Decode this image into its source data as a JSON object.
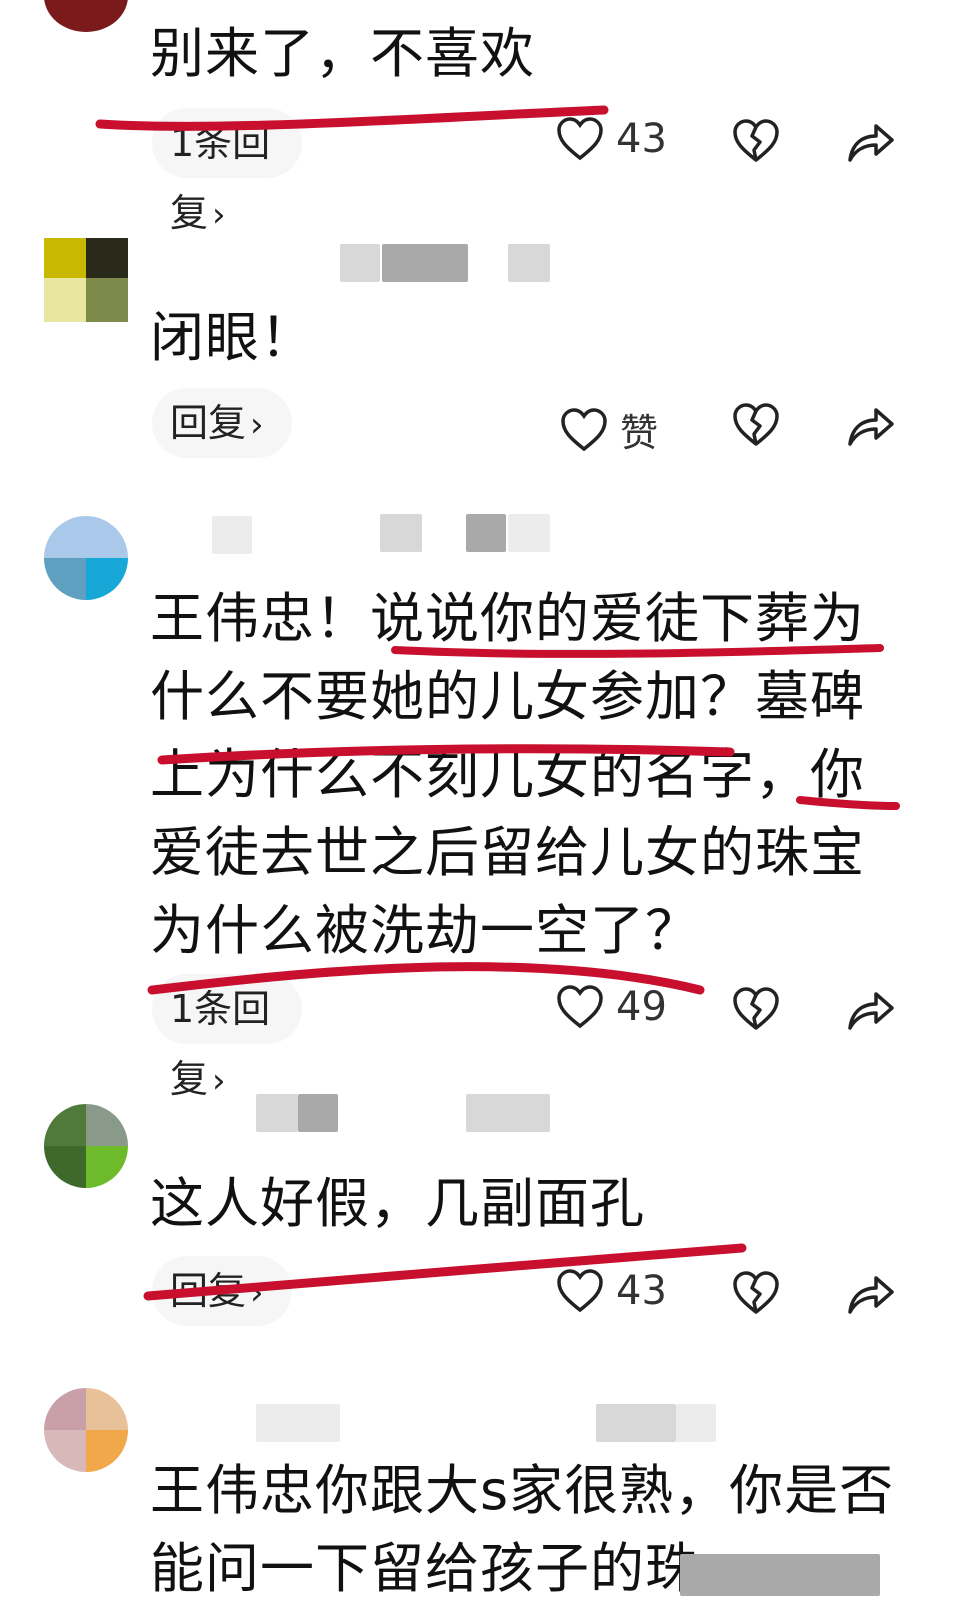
{
  "colors": {
    "underline": "#c8102e",
    "text": "#111111",
    "chip_bg": "#f6f6f6"
  },
  "comments": [
    {
      "text": "别来了，不喜欢",
      "reply": "1条回复",
      "reply_chevron": "›",
      "likes": "43"
    },
    {
      "text": "闭眼！",
      "reply": "回复",
      "reply_chevron": "›",
      "likes": "赞"
    },
    {
      "text_lines": [
        "王伟忠！说说你的爱徒下葬为",
        "什么不要她的儿女参加？墓碑",
        "上为什么不刻儿女的名字，你",
        "爱徒去世之后留给儿女的珠宝",
        "为什么被洗劫一空了？"
      ],
      "reply": "1条回复",
      "reply_chevron": "›",
      "likes": "49"
    },
    {
      "text": "这人好假，几副面孔",
      "reply": "回复",
      "reply_chevron": "›",
      "likes": "43"
    },
    {
      "text_lines": [
        "王伟忠你跟大s家很熟，你是否",
        "能问一下留给孩子的珠"
      ]
    }
  ],
  "icons": {
    "like": "heart-outline-icon",
    "dislike": "broken-heart-icon",
    "share": "share-arrow-icon"
  }
}
